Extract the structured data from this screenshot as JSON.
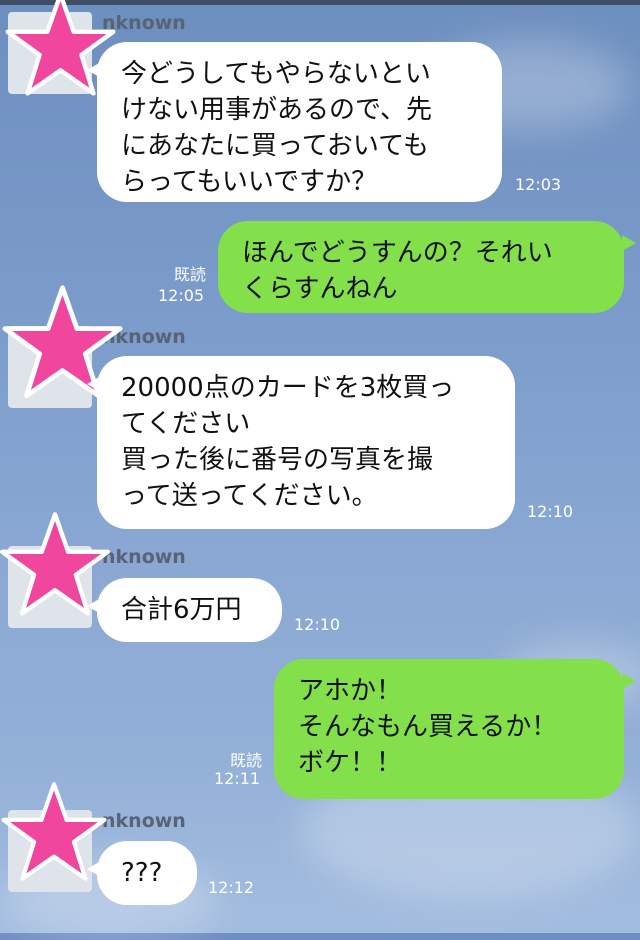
{
  "colors": {
    "sent_bubble": "#84e04a",
    "received_bubble": "#ffffff",
    "star": "#f0469e"
  },
  "messages": [
    {
      "sender": "nknown",
      "text": "今どうしてもやらないとい\nけない用事があるので、先\nにあなたに買っておいても\nらってもいいですか？",
      "time": "12:03"
    },
    {
      "text": "ほんでどうすんの？それい\nくらすんねん",
      "read": "既読",
      "time": "12:05"
    },
    {
      "sender": "nknown",
      "text": "20000点のカードを3枚買っ\nてください\n買った後に番号の写真を撮\nって送ってください。",
      "time": "12:10"
    },
    {
      "sender": "nknown",
      "text": "合計6万円",
      "time": "12:10"
    },
    {
      "text": "アホか！\nそんなもん買えるか！\nボケ！！",
      "read": "既読",
      "time": "12:11"
    },
    {
      "sender": "nknown",
      "text": "???",
      "time": "12:12"
    }
  ]
}
